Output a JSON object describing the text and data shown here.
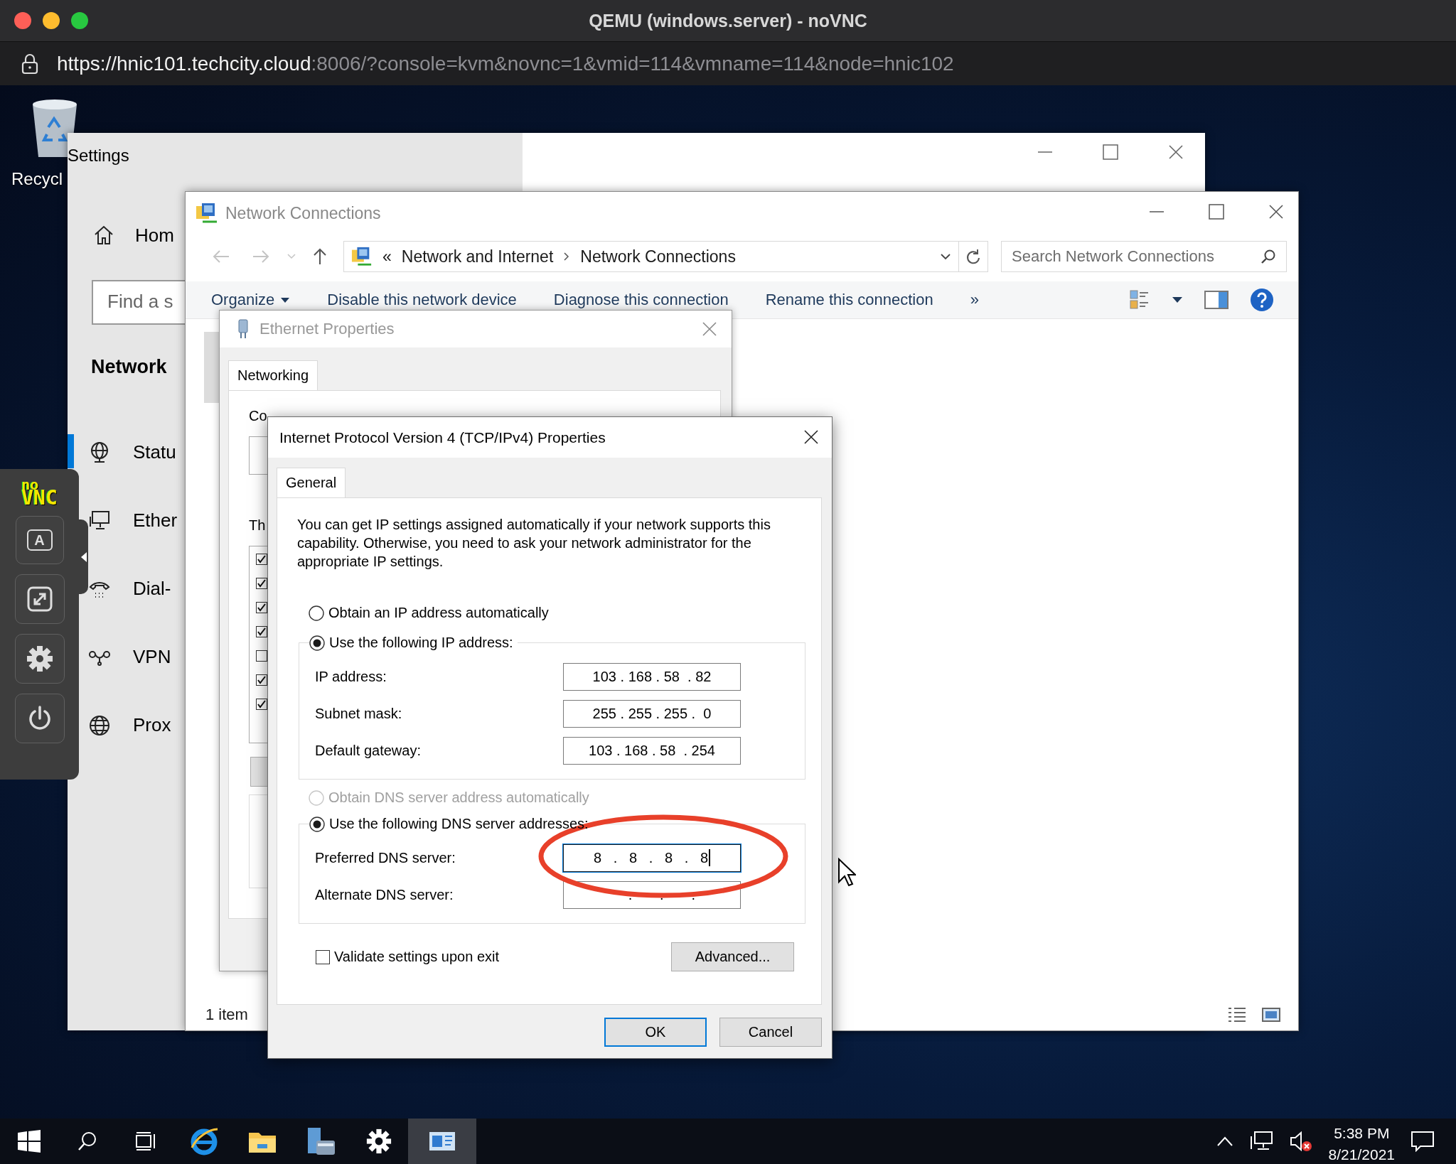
{
  "browser": {
    "title": "QEMU (windows.server) - noVNC",
    "url": {
      "scheme": "https://",
      "host": "hnic101.techcity.cloud",
      "rest": ":8006/?console=kvm&novnc=1&vmid=114&vmname=114&node=hnic102"
    }
  },
  "desktop_icons": [
    {
      "label": "Recycl"
    }
  ],
  "settings": {
    "title": "Settings",
    "home": "Hom",
    "search": {
      "placeholder": "Find a s"
    },
    "section": "Network",
    "nav": [
      {
        "kind": "status",
        "label": "Statu",
        "selected": true
      },
      {
        "kind": "ethernet",
        "label": "Ether",
        "selected": false
      },
      {
        "kind": "dialup",
        "label": "Dial-",
        "selected": false
      },
      {
        "kind": "vpn",
        "label": "VPN",
        "selected": false
      },
      {
        "kind": "proxy",
        "label": "Prox",
        "selected": false
      }
    ]
  },
  "novnc": {
    "logo_top": "no",
    "logo_bottom": "VNC",
    "buttons": [
      {
        "kind": "keyboard",
        "label": "A"
      },
      {
        "kind": "fullscreen"
      },
      {
        "kind": "settings"
      },
      {
        "kind": "power"
      }
    ]
  },
  "network_connections": {
    "title": "Network Connections",
    "breadcrumb_prefix": "«",
    "breadcrumb": [
      "Network and Internet",
      "Network Connections"
    ],
    "search": {
      "placeholder": "Search Network Connections"
    },
    "commands": [
      {
        "label": "Organize",
        "dropdown": true
      },
      {
        "label": "Disable this network device",
        "dropdown": false
      },
      {
        "label": "Diagnose this connection",
        "dropdown": false
      },
      {
        "label": "Rename this connection",
        "dropdown": false
      }
    ],
    "overflow": "»",
    "status_bar": "1 item"
  },
  "ethernet_properties": {
    "title": "Ethernet Properties",
    "tabs": [
      {
        "label": "Networking",
        "selected": true
      }
    ],
    "connect_label": "Co",
    "items_label": "Th",
    "components": [
      {
        "checked": true
      },
      {
        "checked": true
      },
      {
        "checked": true
      },
      {
        "checked": true
      },
      {
        "checked": false
      },
      {
        "checked": true
      },
      {
        "checked": true
      }
    ]
  },
  "ipv4_dialog": {
    "title": "Internet Protocol Version 4 (TCP/IPv4) Properties",
    "tabs": [
      {
        "label": "General",
        "selected": true
      }
    ],
    "description": "You can get IP settings assigned automatically if your network supports this capability. Otherwise, you need to ask your network administrator for the appropriate IP settings.",
    "ip_auto": {
      "label": "Obtain an IP address automatically",
      "selected": false,
      "disabled": false
    },
    "ip_manual": {
      "label": "Use the following IP address:",
      "selected": true,
      "disabled": false
    },
    "ip_fields": [
      {
        "label": "IP address:",
        "value": "103 . 168 . 58  . 82",
        "focused": false
      },
      {
        "label": "Subnet mask:",
        "value": "255 . 255 . 255 .  0",
        "focused": false
      },
      {
        "label": "Default gateway:",
        "value": "103 . 168 . 58  . 254",
        "focused": false
      }
    ],
    "dns_auto": {
      "label": "Obtain DNS server address automatically",
      "selected": false,
      "disabled": true
    },
    "dns_manual": {
      "label": "Use the following DNS server addresses:",
      "selected": true,
      "disabled": false
    },
    "dns_fields": [
      {
        "label": "Preferred DNS server:",
        "value": "8   .   8   .   8   .   8",
        "focused": true
      },
      {
        "label": "Alternate DNS server:",
        "value": "     .       .       .",
        "focused": false
      }
    ],
    "validate": {
      "label": "Validate settings upon exit",
      "checked": false
    },
    "advanced": "Advanced...",
    "buttons": [
      {
        "label": "OK",
        "default": true
      },
      {
        "label": "Cancel",
        "default": false
      }
    ]
  },
  "annotation": {
    "kind": "ellipse",
    "color": "#e8402a"
  },
  "taskbar": {
    "apps": [
      {
        "kind": "search",
        "active": false
      },
      {
        "kind": "taskview",
        "active": false
      },
      {
        "kind": "browser",
        "active": false
      },
      {
        "kind": "folder",
        "active": false
      },
      {
        "kind": "server",
        "active": false
      },
      {
        "kind": "settings",
        "active": false
      },
      {
        "kind": "network",
        "active": true
      }
    ],
    "clock": {
      "time": "5:38 PM",
      "date": "8/21/2021"
    }
  }
}
